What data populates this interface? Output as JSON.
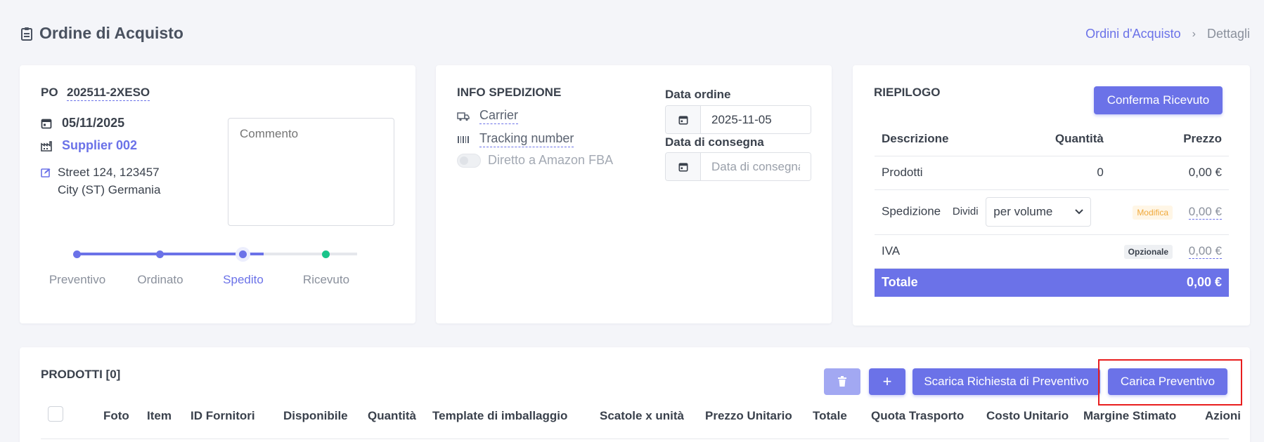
{
  "header": {
    "title": "Ordine di Acquisto"
  },
  "breadcrumb": {
    "parent": "Ordini d'Acquisto",
    "current": "Dettagli"
  },
  "order": {
    "po_label": "PO",
    "po_number": "202511-2XESO",
    "date": "05/11/2025",
    "supplier": "Supplier 002",
    "address_line1": "Street 124, 123457",
    "address_line2": "City (ST) Germania",
    "comment_placeholder": "Commento",
    "steps": [
      {
        "label": "Preventivo"
      },
      {
        "label": "Ordinato"
      },
      {
        "label": "Spedito"
      },
      {
        "label": "Ricevuto"
      }
    ],
    "current_step": 3
  },
  "shipping": {
    "title": "INFO SPEDIZIONE",
    "carrier": "Carrier",
    "tracking": "Tracking number",
    "fba_label": "Diretto a Amazon FBA",
    "order_date_label": "Data ordine",
    "order_date_value": "2025-11-05",
    "delivery_date_label": "Data di consegna",
    "delivery_date_placeholder": "Data di consegna"
  },
  "summary": {
    "title": "RIEPILOGO",
    "confirm_button": "Conferma Ricevuto",
    "columns": [
      "Descrizione",
      "Quantità",
      "Prezzo"
    ],
    "products_label": "Prodotti",
    "products_qty": "0",
    "products_price": "0,00 €",
    "shipping_label": "Spedizione",
    "split_label": "Dividi",
    "split_value": "per volume",
    "edit_badge": "Modifica",
    "shipping_price": "0,00 €",
    "vat_label": "IVA",
    "optional_badge": "Opzionale",
    "vat_price": "0,00 €",
    "total_label": "Totale",
    "total_price": "0,00 €"
  },
  "products": {
    "title": "PRODOTTI [0]",
    "add_symbol": "+",
    "download_button": "Scarica Richiesta di Preventivo",
    "upload_button": "Carica Preventivo",
    "columns": [
      "Foto",
      "Item",
      "ID Fornitori",
      "Disponibile",
      "Quantità",
      "Template di imballaggio",
      "Scatole x unità",
      "Prezzo Unitario",
      "Totale",
      "Quota Trasporto",
      "Costo Unitario",
      "Margine Stimato",
      "Azioni"
    ]
  },
  "colors": {
    "accent": "#6b72e8",
    "success": "#19c48a",
    "highlight": "#e81e1e"
  }
}
